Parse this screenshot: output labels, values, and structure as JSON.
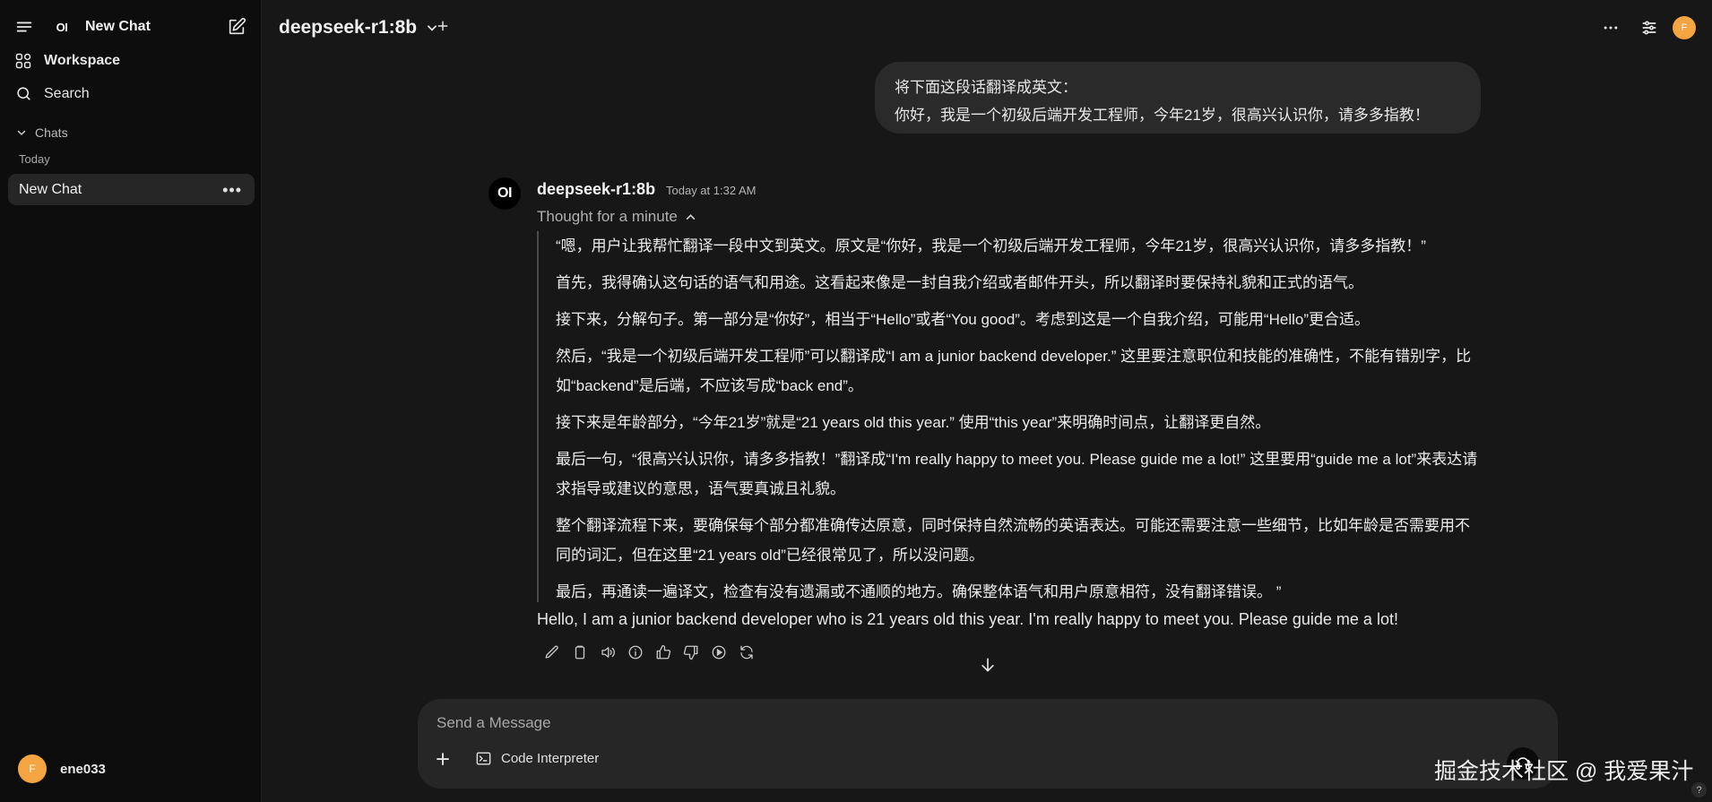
{
  "sidebar": {
    "logo_text": "OI",
    "new_chat_label": "New Chat",
    "workspace_label": "Workspace",
    "search_label": "Search",
    "chats_section_label": "Chats",
    "group_today_label": "Today",
    "chat_items": [
      {
        "label": "New Chat"
      }
    ],
    "user": {
      "avatar_initial": "F",
      "name": "ene033"
    }
  },
  "header": {
    "model_name": "deepseek-r1:8b",
    "user_avatar_initial": "F"
  },
  "conversation": {
    "user_message": {
      "line1": "将下面这段话翻译成英文：",
      "line2": "你好，我是一个初级后端开发工程师，今年21岁，很高兴认识你，请多多指教！"
    },
    "assistant": {
      "avatar_text": "OI",
      "name": "deepseek-r1:8b",
      "timestamp": "Today at 1:32 AM",
      "thought_label": "Thought for a minute",
      "reasoning": [
        "“嗯，用户让我帮忙翻译一段中文到英文。原文是“你好，我是一个初级后端开发工程师，今年21岁，很高兴认识你，请多多指教！”",
        "首先，我得确认这句话的语气和用途。这看起来像是一封自我介绍或者邮件开头，所以翻译时要保持礼貌和正式的语气。",
        "接下来，分解句子。第一部分是“你好”，相当于“Hello”或者“You good”。考虑到这是一个自我介绍，可能用“Hello”更合适。",
        "然后，“我是一个初级后端开发工程师”可以翻译成“I am a junior backend developer.” 这里要注意职位和技能的准确性，不能有错别字，比如“backend”是后端，不应该写成“back end”。",
        "接下来是年龄部分，“今年21岁”就是“21 years old this year.” 使用“this year”来明确时间点，让翻译更自然。",
        "最后一句，“很高兴认识你，请多多指教！”翻译成“I'm really happy to meet you. Please guide me a lot!” 这里要用“guide me a lot”来表达请求指导或建议的意思，语气要真诚且礼貌。",
        "整个翻译流程下来，要确保每个部分都准确传达原意，同时保持自然流畅的英语表达。可能还需要注意一些细节，比如年龄是否需要用不同的词汇，但在这里“21 years old”已经很常见了，所以没问题。",
        "最后，再通读一遍译文，检查有没有遗漏或不通顺的地方。确保整体语气和用户原意相符，没有翻译错误。 ”"
      ],
      "answer": "Hello, I am a junior backend developer who is 21 years old this year. I'm really happy to meet you. Please guide me a lot!"
    }
  },
  "composer": {
    "placeholder": "Send a Message",
    "code_interpreter_label": "Code Interpreter"
  },
  "watermark": "掘金技术社区 @ 我爱果汁",
  "help_label": "?"
}
